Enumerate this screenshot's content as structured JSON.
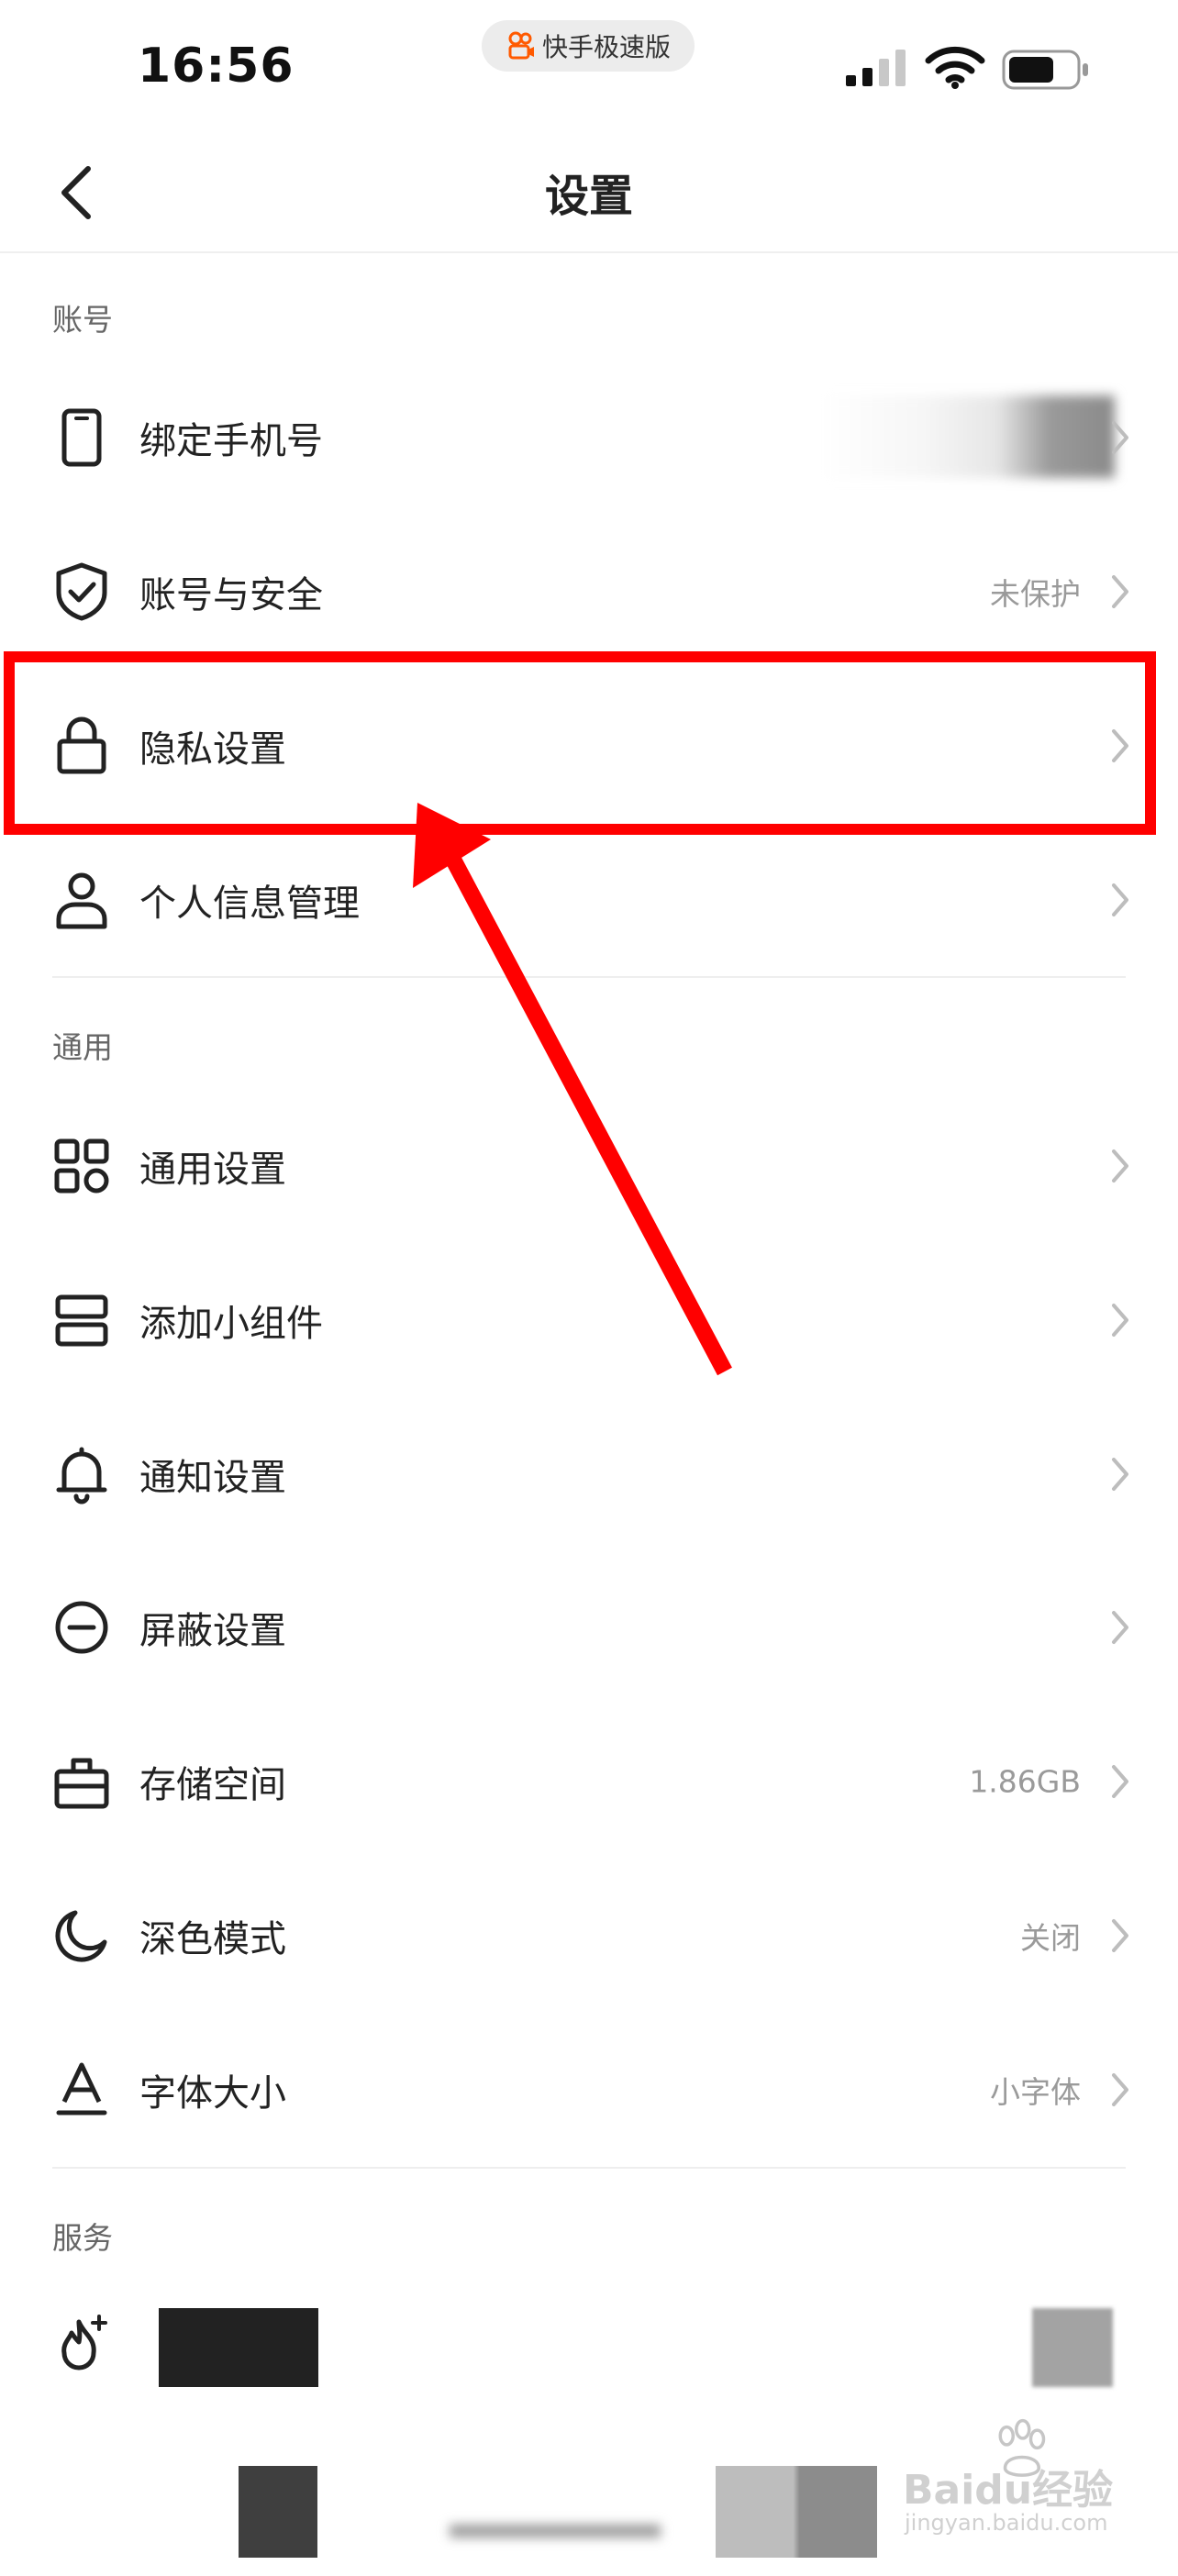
{
  "status_bar": {
    "time": "16:56",
    "app_name": "快手极速版"
  },
  "nav": {
    "title": "设置"
  },
  "sections": {
    "account": {
      "header": "账号",
      "items": [
        {
          "label": "绑定手机号",
          "value": "",
          "icon": "phone-icon"
        },
        {
          "label": "账号与安全",
          "value": "未保护",
          "icon": "shield-check-icon"
        },
        {
          "label": "隐私设置",
          "value": "",
          "icon": "lock-icon"
        },
        {
          "label": "个人信息管理",
          "value": "",
          "icon": "person-icon"
        }
      ]
    },
    "general": {
      "header": "通用",
      "items": [
        {
          "label": "通用设置",
          "value": "",
          "icon": "grid-icon"
        },
        {
          "label": "添加小组件",
          "value": "",
          "icon": "widget-icon"
        },
        {
          "label": "通知设置",
          "value": "",
          "icon": "bell-icon"
        },
        {
          "label": "屏蔽设置",
          "value": "",
          "icon": "block-icon"
        },
        {
          "label": "存储空间",
          "value": "1.86GB",
          "icon": "storage-box-icon"
        },
        {
          "label": "深色模式",
          "value": "关闭",
          "icon": "moon-icon"
        },
        {
          "label": "字体大小",
          "value": "小字体",
          "icon": "font-size-icon"
        }
      ]
    },
    "service": {
      "header": "服务",
      "items": [
        {
          "label": "",
          "icon": "flame-plus-icon"
        }
      ]
    }
  },
  "watermark": {
    "text": "Baidu经验",
    "subtext": "jingyan.baidu.com"
  },
  "colors": {
    "highlight": "#ff0000",
    "text_primary": "#222222",
    "text_secondary": "#9a9a9a",
    "divider": "#eeeeee"
  }
}
